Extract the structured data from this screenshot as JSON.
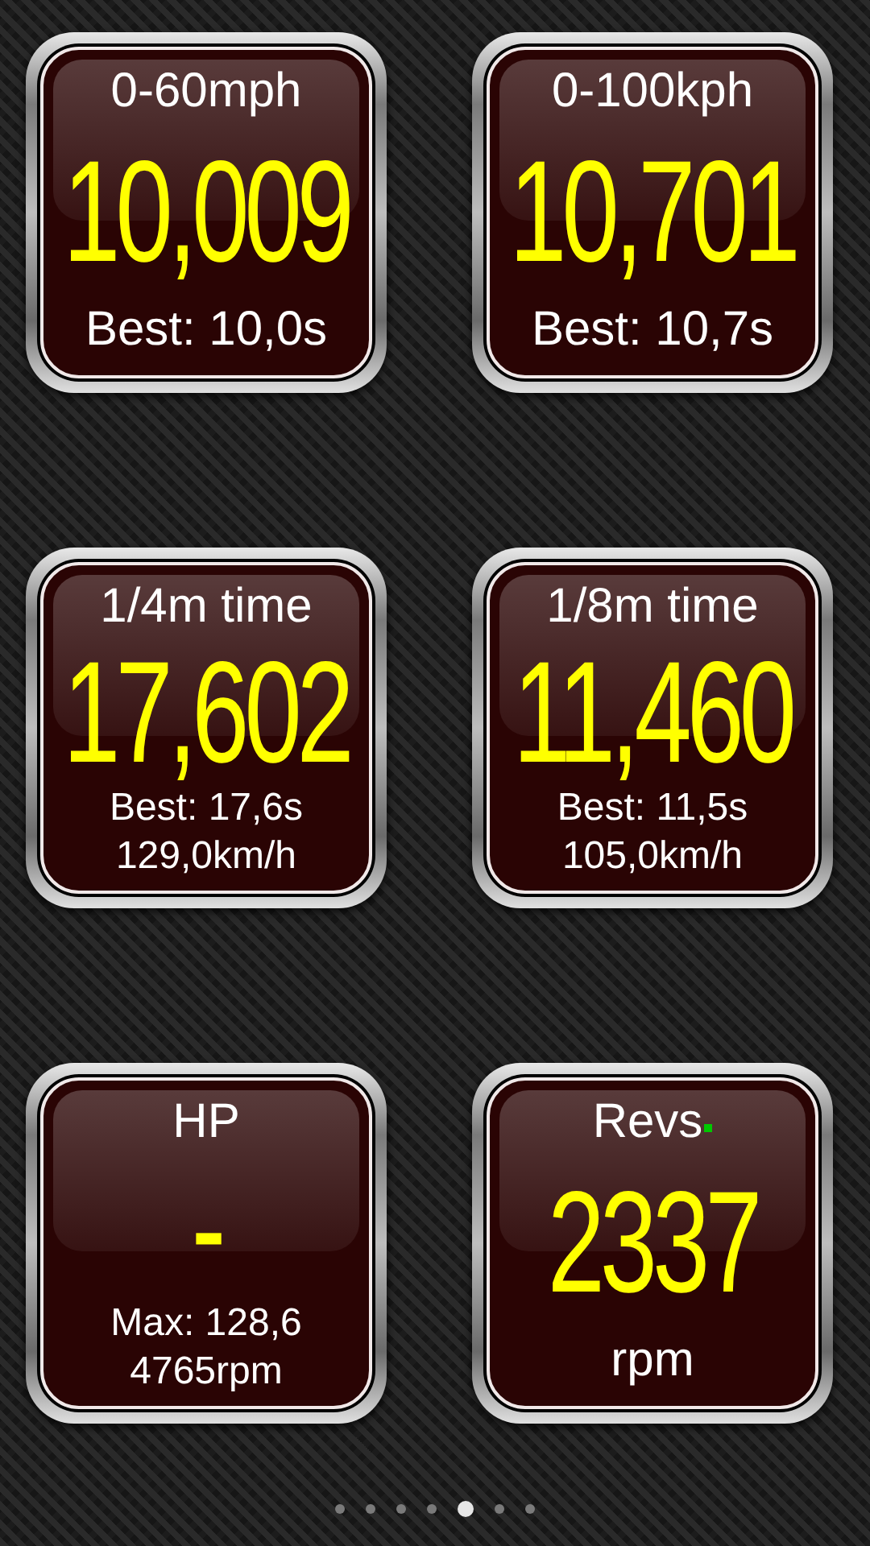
{
  "gauges": [
    {
      "title": "0-60mph",
      "value": "10,009",
      "lines": [
        "Best: 10,0s"
      ]
    },
    {
      "title": "0-100kph",
      "value": "10,701",
      "lines": [
        "Best: 10,7s"
      ]
    },
    {
      "title": "1/4m time",
      "value": "17,602",
      "lines": [
        "Best: 17,6s",
        "129,0km/h"
      ]
    },
    {
      "title": "1/8m time",
      "value": "11,460",
      "lines": [
        "Best: 11,5s",
        "105,0km/h"
      ]
    },
    {
      "title": "HP",
      "value": "-",
      "lines": [
        "Max: 128,6",
        "4765rpm"
      ]
    },
    {
      "title": "Revs",
      "value": "2337",
      "lines": [
        "rpm"
      ],
      "color": "#00c800"
    }
  ],
  "pages": [
    {
      "selected": false
    },
    {
      "selected": false
    },
    {
      "selected": false
    },
    {
      "selected": false
    },
    {
      "selected": true
    },
    {
      "selected": false
    },
    {
      "selected": false
    }
  ]
}
